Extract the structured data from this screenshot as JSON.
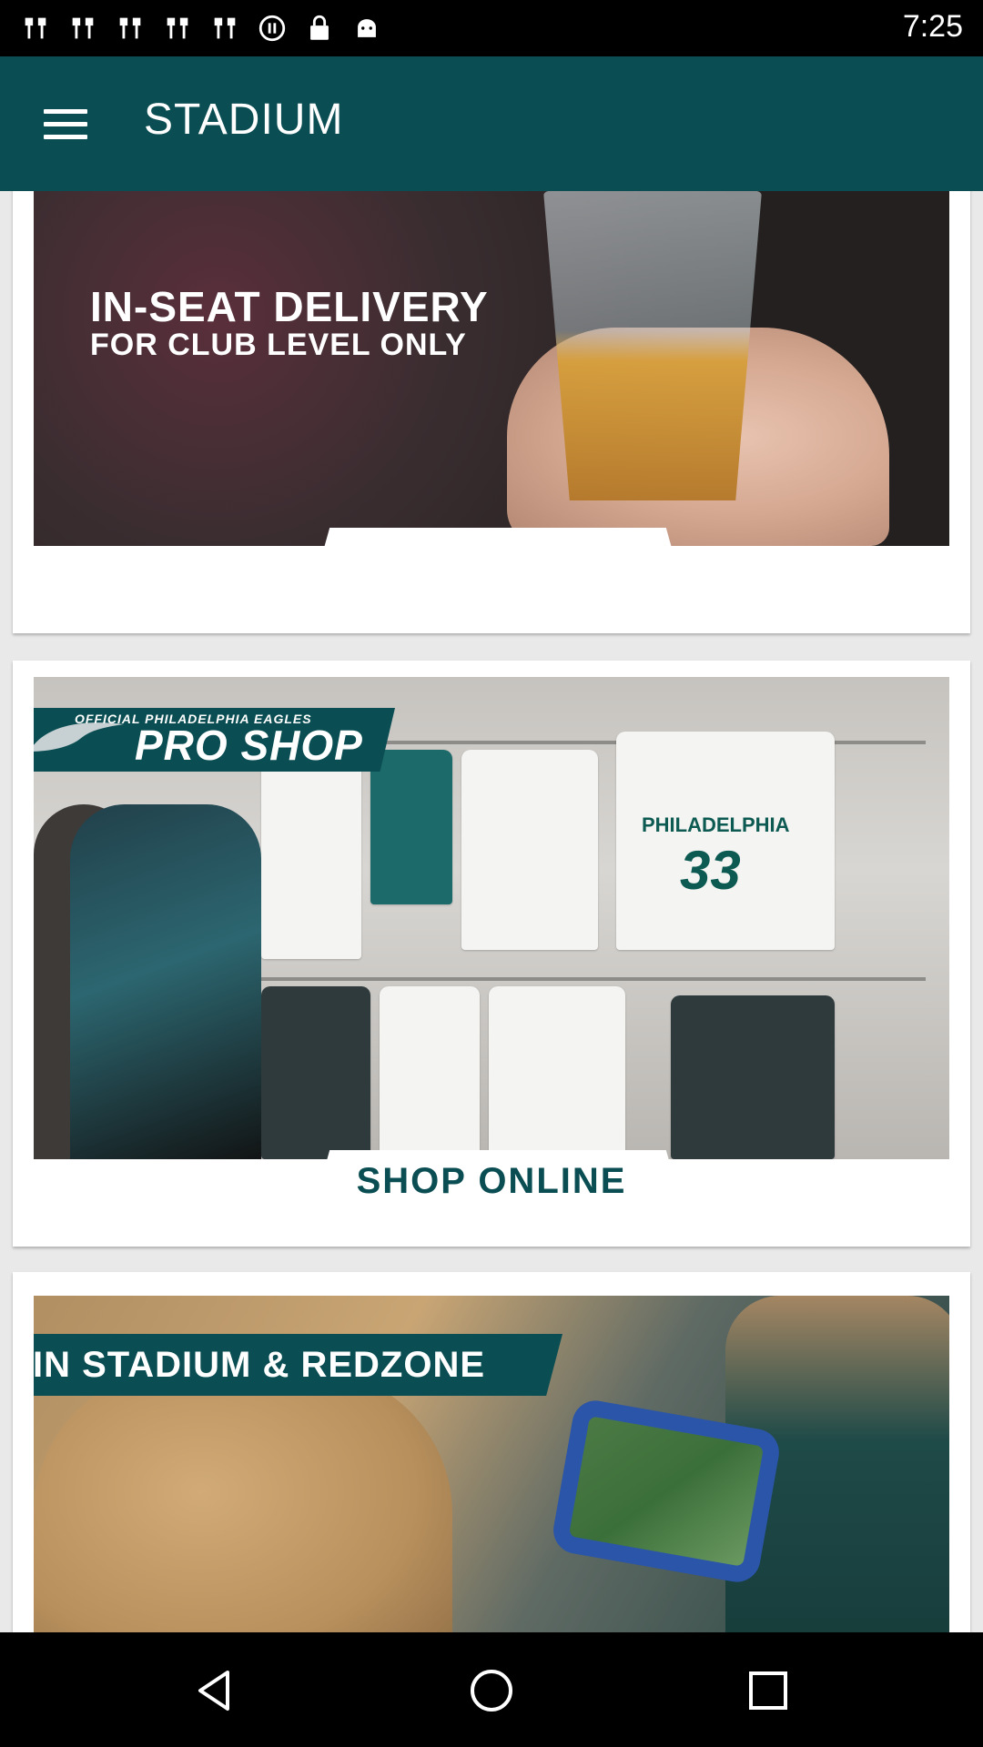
{
  "status_bar": {
    "time": "7:25",
    "left_icons": [
      "notification-icon",
      "notification-icon",
      "notification-icon",
      "notification-icon",
      "notification-icon",
      "media-icon",
      "lock-icon",
      "android-icon"
    ]
  },
  "app_bar": {
    "title": "STADIUM",
    "menu_icon": "hamburger-menu-icon"
  },
  "cards": [
    {
      "name": "in-seat-delivery",
      "headline": "IN-SEAT DELIVERY",
      "subheadline": "FOR CLUB LEVEL ONLY"
    },
    {
      "name": "pro-shop",
      "banner_small": "OFFICIAL PHILADELPHIA EAGLES",
      "banner": "PRO SHOP",
      "jersey_text": "PHILADELPHIA",
      "jersey_number": "33",
      "cta": "SHOP ONLINE"
    },
    {
      "name": "in-stadium-redzone",
      "banner": "IN STADIUM & REDZONE"
    }
  ],
  "nav_bar": {
    "back_icon": "back-icon",
    "home_icon": "home-icon",
    "recent_icon": "recent-apps-icon"
  },
  "colors": {
    "app_bar": "#0a4d52",
    "status_bar": "#000000",
    "background": "#e9e9e9",
    "accent_teal": "#0a4d52"
  }
}
